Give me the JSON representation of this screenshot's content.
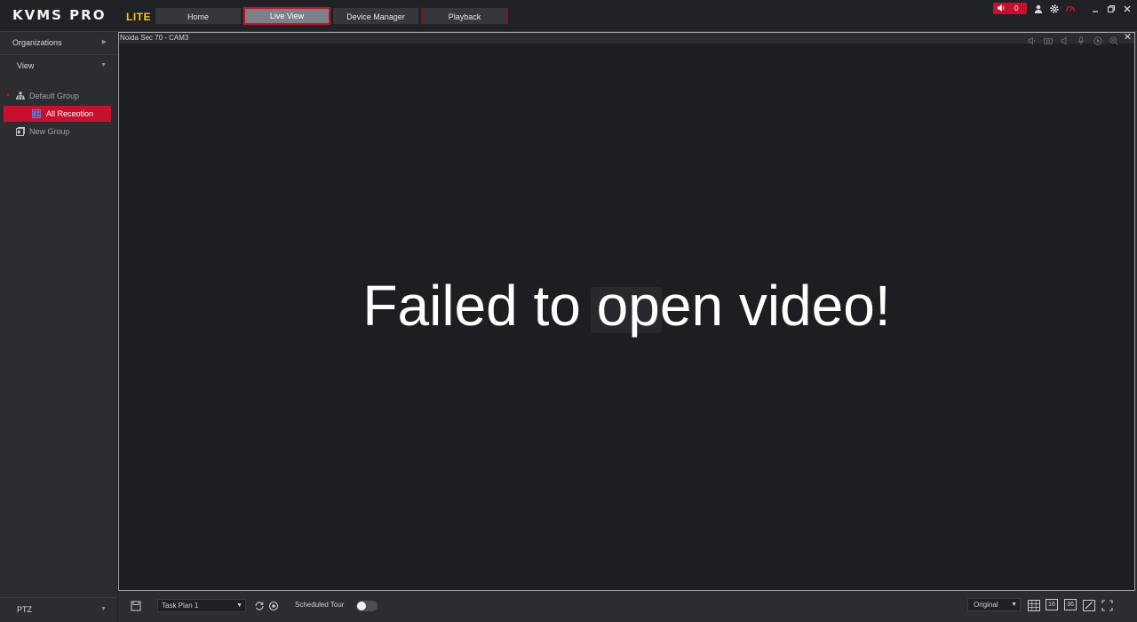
{
  "app": {
    "logo": "KVMS PRO",
    "edition": "LITE"
  },
  "tabs": [
    {
      "label": "Home",
      "active": false
    },
    {
      "label": "Live View",
      "active": true
    },
    {
      "label": "Device Manager",
      "active": false
    },
    {
      "label": "Playback",
      "active": false
    }
  ],
  "titlebar": {
    "alarm_count": "0",
    "icons": [
      "user-icon",
      "settings-icon",
      "performance-icon",
      "minimize-icon",
      "restore-icon",
      "close-icon"
    ]
  },
  "sidebar": {
    "organizations": "Organizations",
    "view": "View",
    "tree": [
      {
        "label": "Default Group",
        "icon": "group-tree-icon"
      },
      {
        "label": "All Receotion",
        "icon": "view-layout-icon",
        "selected": true
      },
      {
        "label": "New Group",
        "icon": "new-group-icon"
      }
    ],
    "ptz": "PTZ"
  },
  "video": {
    "channel_title": "Noida Sec 70 - CAM3",
    "message": "Failed to open video!",
    "tool_icons": [
      "audio-icon",
      "snapshot-icon",
      "speaker-icon",
      "microphone-icon",
      "playback-icon",
      "zoom-icon"
    ]
  },
  "bottom": {
    "task_plan": "Task Plan 1",
    "scheduled_tour_label": "Scheduled Tour",
    "scheduled_tour_on": false,
    "stream_mode": "Original",
    "layout_16": "16",
    "layout_36": "36"
  },
  "colors": {
    "accent": "#c8102e",
    "lite": "#f5c518",
    "background": "#2b2d31",
    "video_bg": "#1c1e22"
  }
}
